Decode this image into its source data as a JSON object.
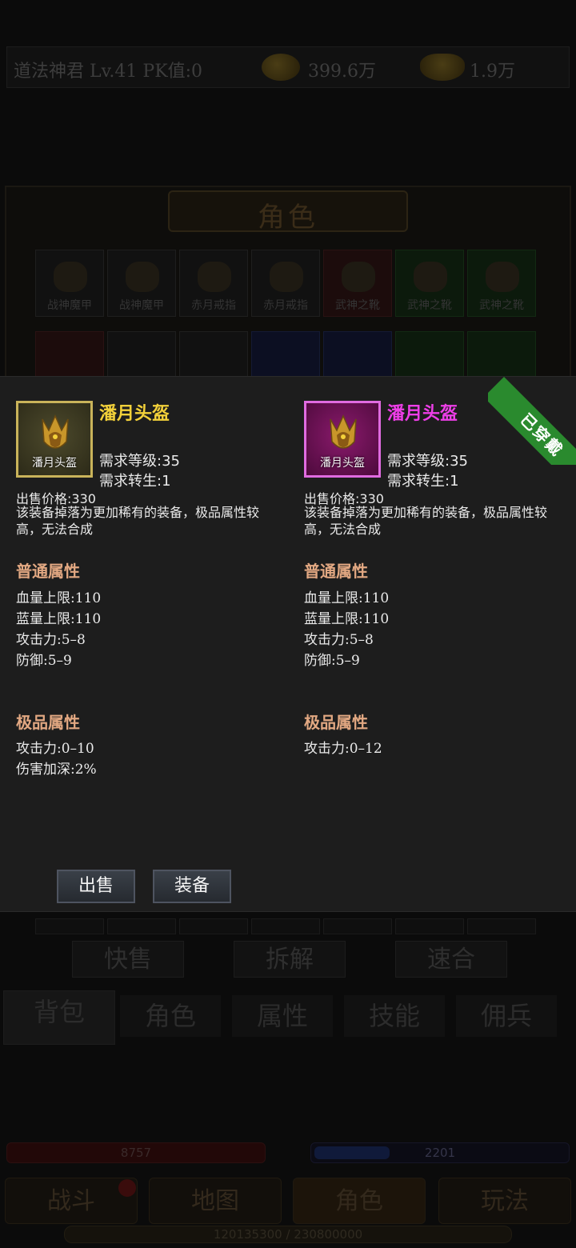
{
  "topbar": {
    "player": "道法神君  Lv.41 PK值:0",
    "gold": "399.6万",
    "ingot": "1.9万"
  },
  "role_panel": {
    "title": "角色",
    "row1": [
      {
        "label": "战神魔甲",
        "color": "plain"
      },
      {
        "label": "战神魔甲",
        "color": "plain"
      },
      {
        "label": "赤月戒指",
        "color": "plain"
      },
      {
        "label": "赤月戒指",
        "color": "plain"
      },
      {
        "label": "武神之靴",
        "color": "red"
      },
      {
        "label": "武神之靴",
        "color": "green"
      },
      {
        "label": "武神之靴",
        "color": "green"
      }
    ],
    "row2_colors": [
      "red",
      "plain",
      "plain",
      "blue",
      "blue",
      "green",
      "green"
    ]
  },
  "actions": {
    "quick_sell": "快售",
    "disassemble": "拆解",
    "fuse": "速合"
  },
  "tabs": [
    "背包",
    "角色",
    "属性",
    "技能",
    "佣兵"
  ],
  "status": {
    "hp": "8757",
    "mp": "2201",
    "exp": "120135300 / 230800000"
  },
  "bottom_nav": [
    "战斗",
    "地图",
    "角色",
    "玩法"
  ],
  "popup": {
    "left_item": {
      "name": "潘月头盔",
      "icon_label": "潘月头盔",
      "req_level": "需求等级:35",
      "req_reborn": "需求转生:1",
      "price": "出售价格:330",
      "desc": "该装备掉落为更加稀有的装备，极品属性较高，无法合成",
      "normal_title": "普通属性",
      "normal_attrs": [
        "血量上限:110",
        "蓝量上限:110",
        "攻击力:5–8",
        "防御:5–9"
      ],
      "special_title": "极品属性",
      "special_attrs": [
        "攻击力:0–10",
        "伤害加深:2%"
      ]
    },
    "right_item": {
      "name": "潘月头盔",
      "icon_label": "潘月头盔",
      "req_level": "需求等级:35",
      "req_reborn": "需求转生:1",
      "price": "出售价格:330",
      "desc": "该装备掉落为更加稀有的装备，极品属性较高，无法合成",
      "normal_title": "普通属性",
      "normal_attrs": [
        "血量上限:110",
        "蓝量上限:110",
        "攻击力:5–8",
        "防御:5–9"
      ],
      "special_title": "极品属性",
      "special_attrs": [
        "攻击力:0–12"
      ],
      "equipped_badge": "已穿戴"
    },
    "sell_button": "出售",
    "equip_button": "装备"
  },
  "colors": {
    "gold_name": "#f3d13a",
    "magenta_name": "#ee3ee8",
    "section_title": "#e2a882",
    "equipped_ribbon": "#2a8a2e"
  }
}
